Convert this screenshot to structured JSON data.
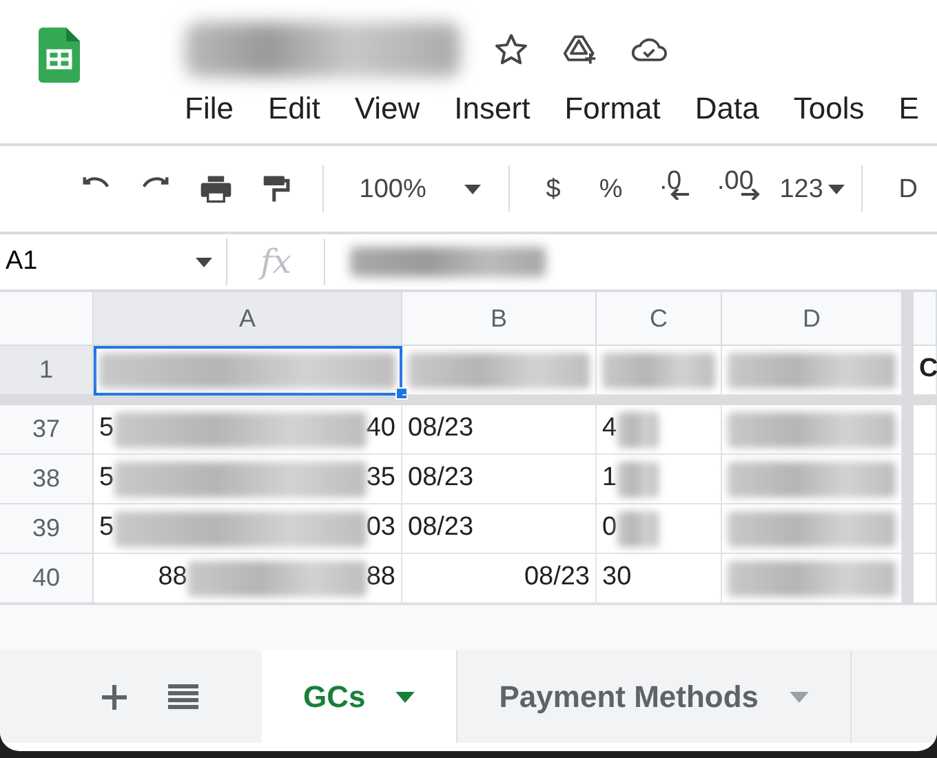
{
  "title": {
    "redacted": true
  },
  "menu": [
    "File",
    "Edit",
    "View",
    "Insert",
    "Format",
    "Data",
    "Tools",
    "E"
  ],
  "toolbar": [
    {
      "kind": "undo"
    },
    {
      "kind": "redo"
    },
    {
      "kind": "print"
    },
    {
      "kind": "paint"
    },
    {
      "kind": "sep"
    },
    {
      "kind": "zoom",
      "label": "100%"
    },
    {
      "kind": "sep"
    },
    {
      "kind": "text",
      "label": "$"
    },
    {
      "kind": "text",
      "label": "%"
    },
    {
      "kind": "dec-less",
      "label": ".0"
    },
    {
      "kind": "dec-more",
      "label": ".00"
    },
    {
      "kind": "menu",
      "label": "123"
    },
    {
      "kind": "sep"
    },
    {
      "kind": "text",
      "label": "D"
    }
  ],
  "name_box": "A1",
  "formula": {
    "label": "fx",
    "redacted": true
  },
  "columns": [
    {
      "label": "A",
      "selected": true
    },
    {
      "label": "B",
      "selected": false
    },
    {
      "label": "C",
      "selected": false
    },
    {
      "label": "D",
      "selected": false
    }
  ],
  "rows": [
    {
      "label": "1",
      "selected": true,
      "cells": [
        {
          "redacted": true
        },
        {
          "redacted": true
        },
        {
          "redacted": true
        },
        {
          "redacted": true
        },
        {
          "text": "C",
          "bold": true
        }
      ]
    },
    {
      "label": "37",
      "selected": false,
      "cells": [
        {
          "text": "5",
          "tail": "40",
          "redacted": true
        },
        {
          "text": "08/23"
        },
        {
          "text": "4",
          "redacted": true
        },
        {
          "redacted": true
        }
      ]
    },
    {
      "label": "38",
      "selected": false,
      "cells": [
        {
          "text": "5",
          "tail": "35",
          "redacted": true
        },
        {
          "text": "08/23"
        },
        {
          "text": "1",
          "redacted": true
        },
        {
          "redacted": true
        }
      ]
    },
    {
      "label": "39",
      "selected": false,
      "cells": [
        {
          "text": "5",
          "tail": "03",
          "redacted": true
        },
        {
          "text": "08/23"
        },
        {
          "text": "0",
          "redacted": true
        },
        {
          "redacted": true
        }
      ]
    },
    {
      "label": "40",
      "selected": false,
      "cells": [
        {
          "text": "88",
          "tail": "88",
          "redacted": true,
          "right_aligned": true
        },
        {
          "text": "08/23",
          "right_aligned": true
        },
        {
          "text": "30"
        },
        {
          "redacted": true
        }
      ]
    }
  ],
  "sheets": [
    {
      "label": "GCs",
      "selected": true
    },
    {
      "label": "Payment Methods",
      "selected": false
    }
  ]
}
